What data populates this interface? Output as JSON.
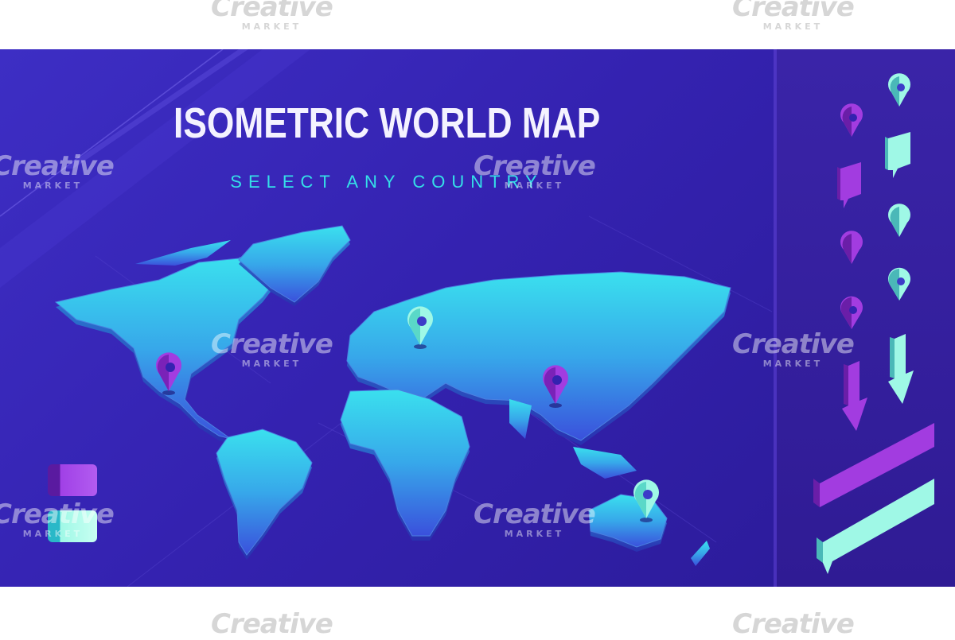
{
  "title": "ISOMETRIC WORLD MAP",
  "subtitle": "SELECT ANY COUNTRY",
  "watermark": {
    "brand": "Creative",
    "sub": "MARKET"
  },
  "colors": {
    "background": "#3422b0",
    "continent_top": "#38d8ec",
    "continent_bottom": "#3a58e0",
    "pin_purple": "#a23ce0",
    "pin_cyan": "#7ff5e2",
    "accent_cyan": "#35e0e8"
  },
  "map_pins": [
    {
      "name": "north-america-pin",
      "color": "purple"
    },
    {
      "name": "europe-pin",
      "color": "cyan"
    },
    {
      "name": "asia-pin",
      "color": "purple"
    },
    {
      "name": "australia-pin",
      "color": "cyan"
    }
  ],
  "swatches": [
    "purple",
    "cyan"
  ],
  "side_icons": [
    "map-pin-icon",
    "speech-bubble-icon",
    "round-pin-icon",
    "location-pin-icon",
    "down-arrow-icon",
    "banner-icon"
  ]
}
